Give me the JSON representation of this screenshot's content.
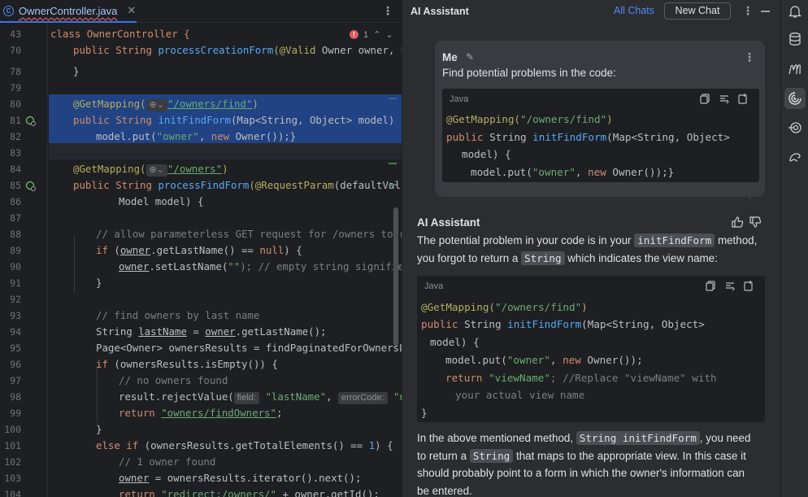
{
  "editor": {
    "tab": {
      "filename": "OwnerController.java",
      "file_icon": "java-class-icon",
      "close": "✕"
    },
    "inspection": {
      "errors": "1"
    },
    "line_numbers": [
      "43",
      "70",
      "",
      "78",
      "79",
      "80",
      "81",
      "82",
      "83",
      "84",
      "85",
      "86",
      "87",
      "88",
      "89",
      "90",
      "91",
      "92",
      "93",
      "94",
      "95",
      "96",
      "97",
      "98",
      "99",
      "100",
      "101",
      "102",
      "103",
      "104"
    ],
    "code": {
      "l43": "class OwnerController {",
      "l70a": "public String ",
      "l70b": "processCreationForm",
      "l70c": "(@Valid",
      "l70d": " Owner owner, Bind",
      "l78": "}",
      "l80a": "@GetMapping(",
      "l80b": "\"/owners/find\"",
      "l80c": ")",
      "l81a": "public String ",
      "l81b": "initFindForm",
      "l81c": "(Map<String, Object> model) {",
      "l82a": "model.put(",
      "l82b": "\"owner\"",
      "l82c": ", ",
      "l82d": "new",
      "l82e": " Owner());}",
      "l84a": "@GetMapping(",
      "l84b": "\"/owners\"",
      "l84c": ")",
      "l85a": "public String ",
      "l85b": "processFindForm",
      "l85c": "(@RequestParam",
      "l85d": "(defaultValue =",
      "l86": "Model model) {",
      "l88": "// allow parameterless GET request for /owners to ret",
      "l89a": "if",
      "l89b": " (",
      "l89c": "owner",
      "l89d": ".getLastName() == ",
      "l89e": "null",
      "l89f": ") {",
      "l90a": "owner",
      "l90b": ".setLastName(",
      "l90c": "\"\"",
      "l90d": "); // empty string signifies b",
      "l91": "}",
      "l93": "// find owners by last name",
      "l94a": "String ",
      "l94b": "lastName",
      "l94c": " = ",
      "l94d": "owner",
      "l94e": ".getLastName();",
      "l95": "Page<Owner> ownersResults = findPaginatedForOwnersLast",
      "l96a": "if",
      "l96b": " (ownersResults.isEmpty()) {",
      "l97": "// no owners found",
      "l98a": "result.rejectValue(",
      "l98b": "field:",
      "l98c": "\"lastName\"",
      "l98d": ", ",
      "l98e": "errorCode:",
      "l98f": "\"not",
      "l99a": "return ",
      "l99b": "\"owners/findOwners\"",
      "l99c": ";",
      "l100": "}",
      "l101a": "else if",
      "l101b": " (ownersResults.getTotalElements() == ",
      "l101c": "1",
      "l101d": ") {",
      "l102": "// 1 owner found",
      "l103a": "owner",
      "l103b": " = ownersResults.iterator().next();",
      "l104a": "return ",
      "l104b": "\"redirect:",
      "l104c": "/owners/",
      "l104d": "\"",
      "l104e": " + ",
      "l104f": "owner",
      "l104g": ".getId();"
    }
  },
  "assistant": {
    "title": "AI Assistant",
    "all_chats": "All Chats",
    "new_chat": "New Chat",
    "me": {
      "name": "Me",
      "message": "Find potential problems in the code:",
      "code_lang": "Java",
      "code": {
        "a1": "@GetMapping(",
        "a2": "\"/owners/find\"",
        "a3": ")",
        "b1": "public",
        "b2": " String ",
        "b3": "initFindForm",
        "b4": "(Map<String, Object>",
        "c1": "model) {",
        "d1": "model.put(",
        "d2": "\"owner\"",
        "d3": ", ",
        "d4": "new",
        "d5": " Owner());}"
      }
    },
    "reply": {
      "name": "AI Assistant",
      "p1a": "The potential problem in your code is in your ",
      "p1b": "initFindForm",
      "p1c": " method,",
      "p1d": "you forgot to return a ",
      "p1e": "String",
      "p1f": " which indicates the view name:",
      "code_lang": "Java",
      "code": {
        "a1": "@GetMapping(",
        "a2": "\"/owners/find\"",
        "a3": ")",
        "b1": "public",
        "b2": " String ",
        "b3": "initFindForm",
        "b4": "(Map<String, Object>",
        "c1": "model) {",
        "d1": "model.put(",
        "d2": "\"owner\"",
        "d3": ", ",
        "d4": "new",
        "d5": " Owner());",
        "e1": "return",
        "e2": " ",
        "e3": "\"viewName\"",
        "e4": "; //Replace \"viewName\" with",
        "f1": "your actual view name",
        "g1": "}"
      },
      "p2a": "In the above mentioned method, ",
      "p2b": "String initFindForm",
      "p2c": ", you need",
      "p2d": "to return a ",
      "p2e": "String",
      "p2f": " that maps to the appropriate view. In this case it",
      "p2g": "should probably point to a form in which the owner's information can",
      "p2h": "be entered."
    }
  },
  "toolstrip": {
    "icons": [
      "notifications-icon",
      "database-icon",
      "markdown-m-icon",
      "ai-assistant-icon",
      "endpoints-icon",
      "gradle-icon"
    ]
  },
  "colors": {
    "editor_bg": "#1e1f22",
    "panel_bg": "#2b2d30",
    "selection": "#214283",
    "keyword": "#cf8e6d",
    "function": "#56a8f5",
    "string": "#6aab73",
    "annotation": "#b3ae60",
    "comment": "#7a7e85",
    "link": "#548af7"
  }
}
